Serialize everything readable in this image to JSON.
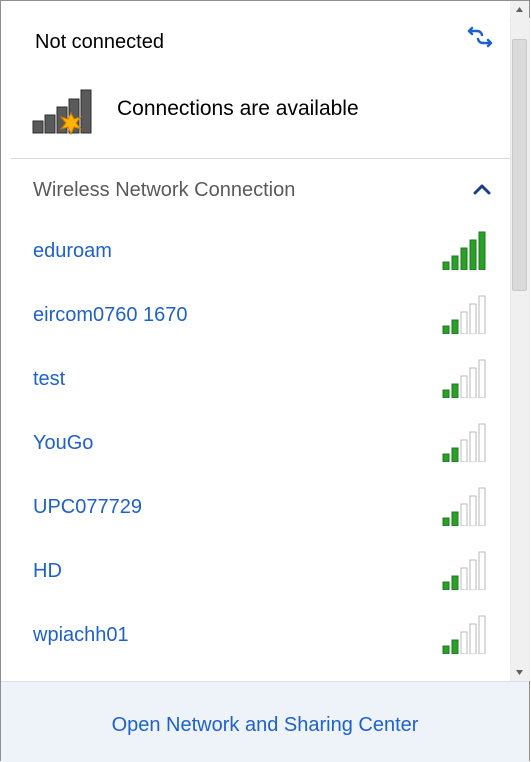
{
  "header": {
    "status_text": "Not connected",
    "availability_text": "Connections are available",
    "refresh_icon": "refresh-arrows-icon",
    "connection_icon": "network-signal-warning-icon"
  },
  "section": {
    "title": "Wireless Network Connection",
    "collapse_icon": "chevron-up-icon"
  },
  "networks": [
    {
      "name": "eduroam",
      "signal_bars": 5
    },
    {
      "name": "eircom0760 1670",
      "signal_bars": 2
    },
    {
      "name": "test",
      "signal_bars": 2
    },
    {
      "name": "YouGo",
      "signal_bars": 2
    },
    {
      "name": "UPC077729",
      "signal_bars": 2
    },
    {
      "name": "HD",
      "signal_bars": 2
    },
    {
      "name": "wpiachh01",
      "signal_bars": 2
    }
  ],
  "footer": {
    "link_text": "Open Network and Sharing Center"
  },
  "colors": {
    "link_blue": "#1e62c9",
    "signal_green": "#2aa02a",
    "signal_gray": "#b8b8b8",
    "footer_bg": "#eef3fa"
  }
}
